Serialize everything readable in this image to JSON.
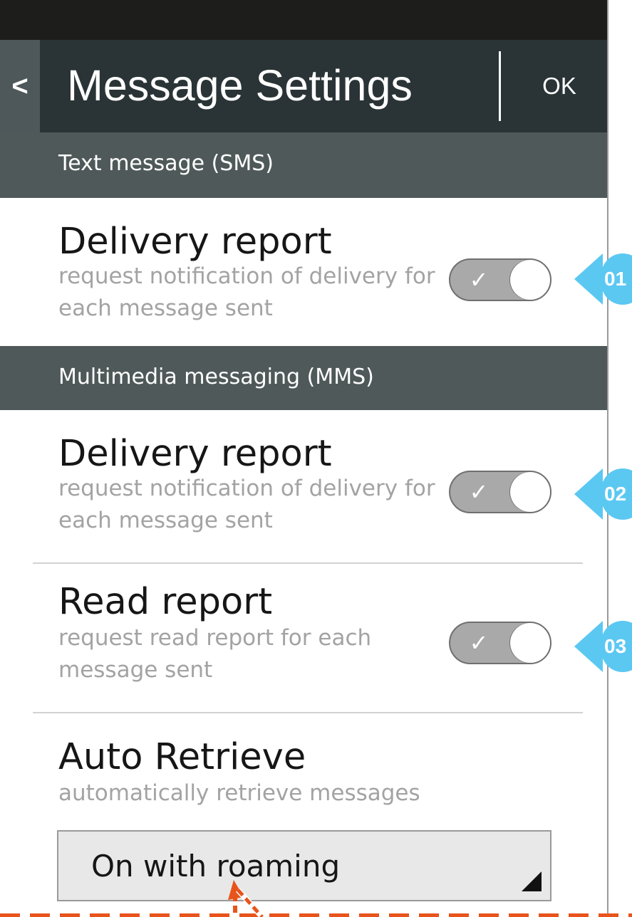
{
  "header": {
    "back_label": "<",
    "title": "Message Settings",
    "ok_label": "OK"
  },
  "sections": {
    "sms": {
      "label": "Text message (SMS)"
    },
    "mms": {
      "label": "Multimedia messaging (MMS)"
    }
  },
  "settings": {
    "sms_delivery": {
      "title": "Delivery report",
      "description": "request notification of delivery for each message sent",
      "check": "✓",
      "enabled": true
    },
    "mms_delivery": {
      "title": "Delivery report",
      "description": "request notification of delivery for each message sent",
      "check": "✓",
      "enabled": true
    },
    "mms_read": {
      "title": "Read report",
      "description": "request read report for each message sent",
      "check": "✓",
      "enabled": true
    },
    "auto_retrieve": {
      "title": "Auto Retrieve",
      "description": "automatically retrieve messages",
      "selected": "On with roaming"
    }
  },
  "callouts": [
    "01",
    "02",
    "03"
  ],
  "colors": {
    "status_bar": "#1d1e1c",
    "header": "#2a3436",
    "section_header": "#4f595a",
    "toggle": "#a9a9a9",
    "callout": "#5bc8f2",
    "annotation": "#e8541c"
  }
}
